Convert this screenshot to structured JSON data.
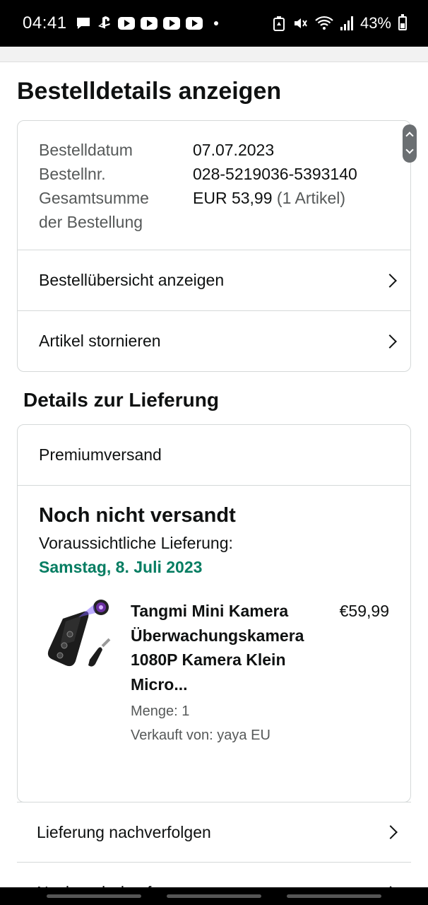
{
  "status_bar": {
    "time": "04:41",
    "battery": "43%",
    "icons": [
      "message-icon",
      "playstation-icon",
      "youtube-icon",
      "youtube-icon",
      "youtube-icon",
      "youtube-icon",
      "dot-icon",
      "battery-saver-icon",
      "mute-icon",
      "wifi-icon",
      "signal-icon",
      "battery-icon"
    ]
  },
  "page": {
    "title": "Bestelldetails anzeigen"
  },
  "order": {
    "date_label": "Bestelldatum",
    "date_value": "07.07.2023",
    "number_label": "Bestellnr.",
    "number_value": "028-5219036-5393140",
    "total_label_line1": "Gesamtsumme",
    "total_label_line2": "der Bestellung",
    "total_value": "EUR 53,99",
    "total_items": "(1 Artikel)",
    "link_overview": "Bestellübersicht anzeigen",
    "link_cancel": "Artikel stornieren"
  },
  "delivery": {
    "section_title": "Details zur Lieferung",
    "shipping_method": "Premiumversand",
    "status": "Noch nicht versandt",
    "expected_label": "Voraussichtliche Lieferung:",
    "expected_date": "Samstag, 8. Juli 2023",
    "item": {
      "title": "Tangmi Mini Kamera Überwachungskamera 1080P Kamera Klein Micro...",
      "price": "€59,99",
      "quantity": "Menge: 1",
      "seller": "Verkauft von: yaya EU"
    }
  },
  "actions": {
    "track": "Lieferung nachverfolgen",
    "next_partial": "Noch mehr kaufen"
  },
  "colors": {
    "delivery_date": "#067d62",
    "border": "#d5d9d9",
    "muted": "#565959"
  }
}
